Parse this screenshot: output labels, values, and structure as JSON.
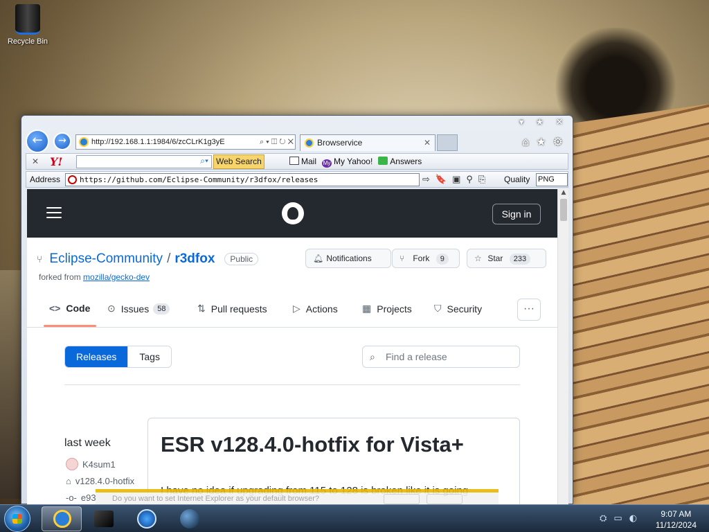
{
  "desktop": {
    "recycle_bin_label": "Recycle Bin"
  },
  "window": {
    "caption_buttons": [
      "▾",
      "★",
      "✕"
    ]
  },
  "nav": {
    "back_glyph": "←",
    "forward_glyph": "→",
    "address_small": "http://192.168.1.1:1984/6/zcCLrK1g3yE",
    "address_tools": "⌕ ▾ ◫ ↻ ✕",
    "tab_title": "Browservice",
    "tab_close": "✕",
    "right_icons": [
      "⌂",
      "★",
      "⚙"
    ]
  },
  "yahoo_toolbar": {
    "close_glyph": "✕",
    "logo": "Y!",
    "search_button": "Web Search",
    "mail": "Mail",
    "my_yahoo": "My Yahoo!",
    "my_icon_text": "My",
    "answers": "Answers"
  },
  "address_bar": {
    "label": "Address",
    "url": "https://github.com/Eclipse-Community/r3dfox/releases",
    "tools": [
      "⇨",
      "🔖",
      "▣",
      "⚲",
      "⎘"
    ],
    "quality_label": "Quality",
    "quality_value": "PNG"
  },
  "github": {
    "sign_in": "Sign in",
    "owner": "Eclipse-Community",
    "slash": "/",
    "repo": "r3dfox",
    "visibility": "Public",
    "forked_from_prefix": "forked from",
    "forked_from_link": "mozilla/gecko-dev",
    "buttons": {
      "notifications": "Notifications",
      "fork": "Fork",
      "fork_count": "9",
      "star": "Star",
      "star_count": "233"
    },
    "nav": {
      "code": "Code",
      "issues": "Issues",
      "issues_count": "58",
      "pull_requests": "Pull requests",
      "actions": "Actions",
      "projects": "Projects",
      "security": "Security",
      "more": "···"
    },
    "releases_tab": "Releases",
    "tags_tab": "Tags",
    "find_placeholder": "Find a release",
    "release": {
      "date": "last week",
      "author": "K4sum1",
      "tag": "v128.4.0-hotfix",
      "commit": "e93",
      "title": "ESR v128.4.0-hotfix for Vista+",
      "body": "I have no idea if upgrading from 115 to 128 is broken like it is going"
    }
  },
  "notification_strip": {
    "text": "Do you want to set Internet Explorer as your default browser?"
  },
  "taskbar": {
    "tray_icons": [
      "⛭",
      "▭",
      "◐"
    ],
    "time": "9:07 AM",
    "date": "11/12/2024"
  }
}
